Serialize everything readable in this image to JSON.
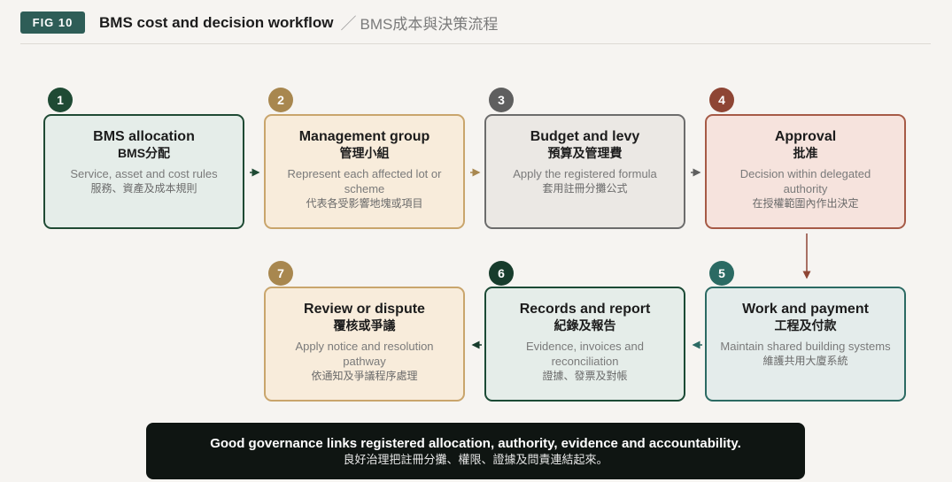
{
  "header": {
    "fig_tag": "FIG 10",
    "title": "BMS cost and decision workflow",
    "separator": "／",
    "subtitle": "BMS成本與決策流程"
  },
  "steps": [
    {
      "num": "1",
      "en": "BMS allocation",
      "zh": "BMS分配",
      "desc": "Service, asset and cost rules",
      "desc_zh": "服務、資產及成本規則",
      "color": "#1f4a34"
    },
    {
      "num": "2",
      "en": "Management group",
      "zh": "管理小組",
      "desc": "Represent each affected lot or scheme",
      "desc_zh": "代表各受影響地塊或項目",
      "color": "#a8874f"
    },
    {
      "num": "3",
      "en": "Budget and levy",
      "zh": "預算及管理費",
      "desc": "Apply the registered formula",
      "desc_zh": "套用註冊分攤公式",
      "color": "#5f5f5f"
    },
    {
      "num": "4",
      "en": "Approval",
      "zh": "批准",
      "desc": "Decision within delegated authority",
      "desc_zh": "在授權範圍內作出決定",
      "color": "#8e4534"
    },
    {
      "num": "5",
      "en": "Work and payment",
      "zh": "工程及付款",
      "desc": "Maintain shared building systems",
      "desc_zh": "維護共用大廈系統",
      "color": "#2b6a63"
    },
    {
      "num": "6",
      "en": "Records and report",
      "zh": "紀錄及報告",
      "desc": "Evidence, invoices and reconciliation",
      "desc_zh": "證據、發票及對帳",
      "color": "#173c2c"
    },
    {
      "num": "7",
      "en": "Review or dispute",
      "zh": "覆核或爭議",
      "desc": "Apply notice and resolution pathway",
      "desc_zh": "依通知及爭議程序處理",
      "color": "#a8874f"
    }
  ],
  "footer": {
    "en": "Good governance links registered allocation, authority, evidence and accountability.",
    "zh": "良好治理把註冊分攤、權限、證據及問責連結起來。"
  }
}
